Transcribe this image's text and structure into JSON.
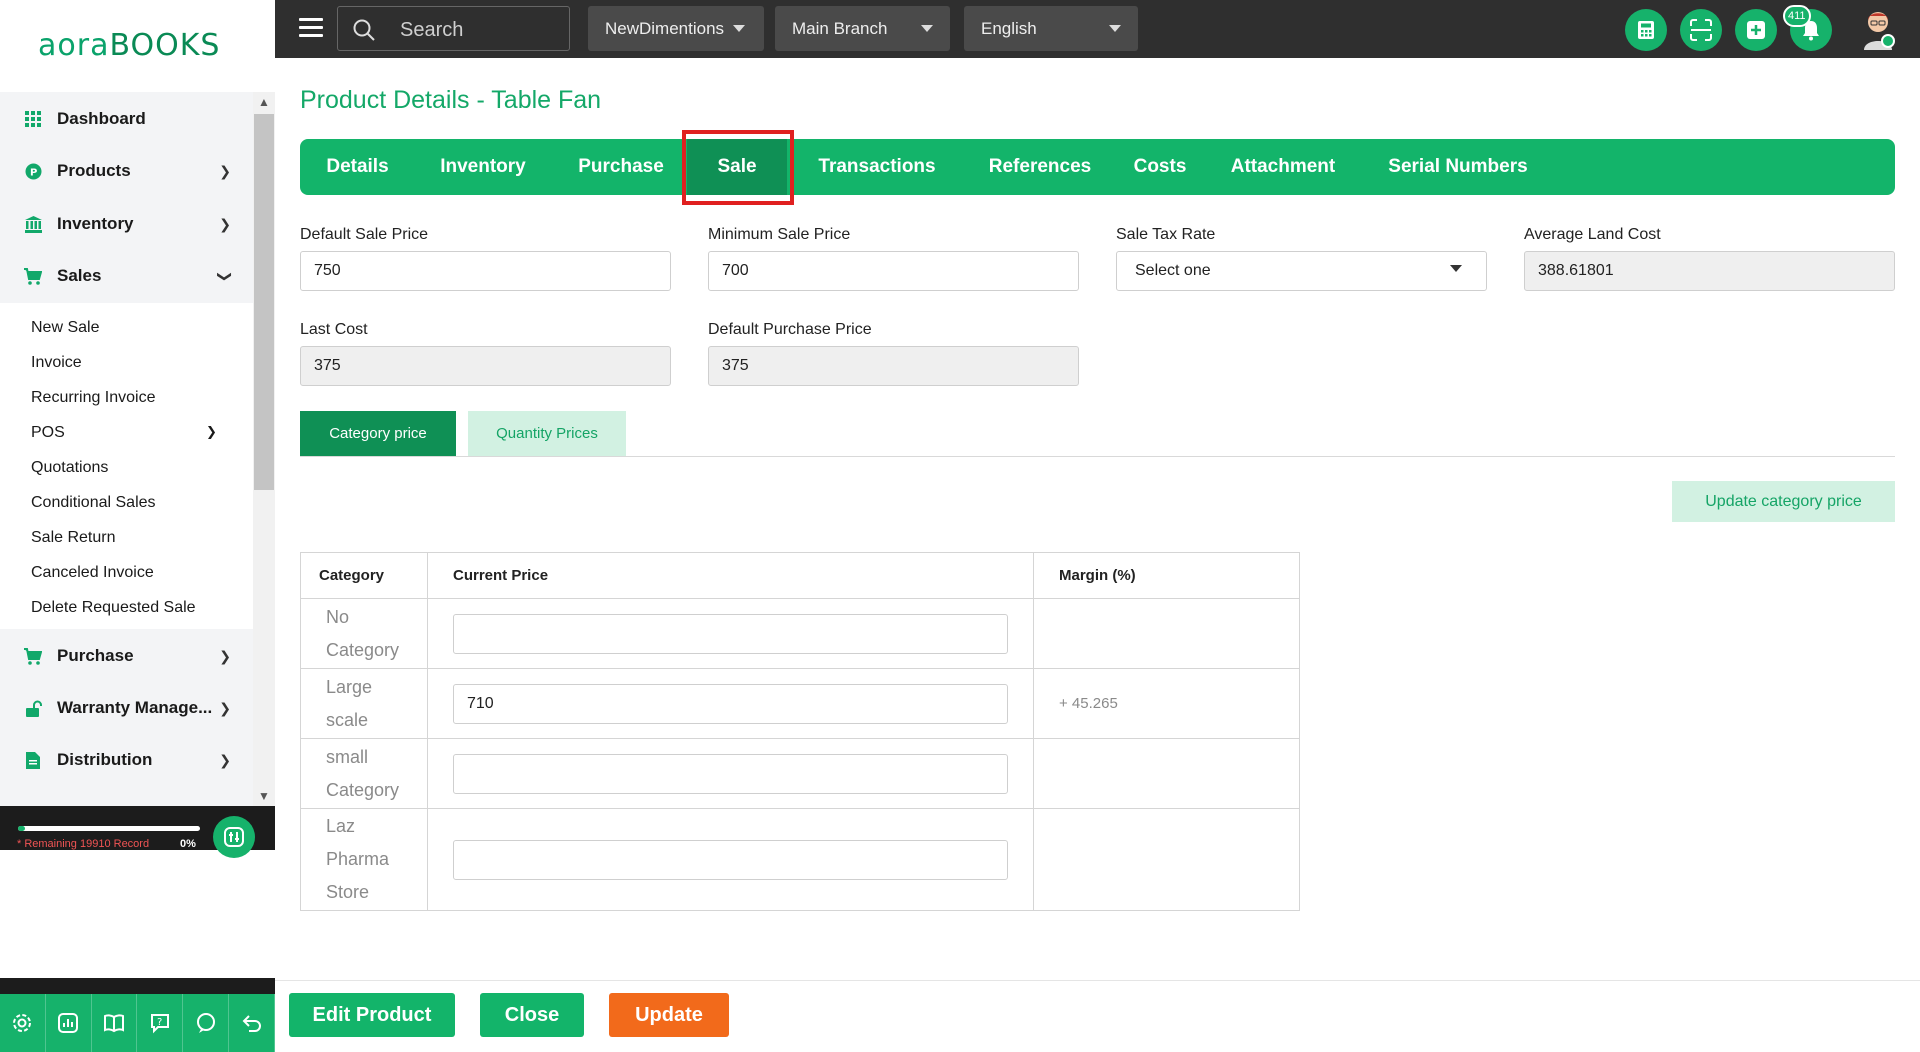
{
  "app": {
    "logo_main": "aora",
    "logo_books": "BOOKS"
  },
  "topbar": {
    "search_placeholder": "Search",
    "company": "NewDimentions",
    "branch": "Main Branch",
    "language": "English",
    "notification_count": "411"
  },
  "sidebar": {
    "items": [
      {
        "label": "Dashboard",
        "icon": "grid-icon"
      },
      {
        "label": "Products",
        "icon": "product-icon"
      },
      {
        "label": "Inventory",
        "icon": "bank-icon"
      },
      {
        "label": "Sales",
        "icon": "cart-icon"
      },
      {
        "label": "Purchase",
        "icon": "cart-icon"
      },
      {
        "label": "Warranty Manage...",
        "icon": "unlock-icon"
      },
      {
        "label": "Distribution",
        "icon": "document-icon"
      }
    ],
    "sales_sub": [
      "New Sale",
      "Invoice",
      "Recurring Invoice",
      "POS",
      "Quotations",
      "Conditional Sales",
      "Sale Return",
      "Canceled Invoice",
      "Delete Requested Sale"
    ],
    "remaining": "* Remaining 19910 Record",
    "percent": "0%",
    "progress": 0.04
  },
  "page": {
    "title": "Product Details - Table Fan",
    "tabs": [
      "Details",
      "Inventory",
      "Purchase",
      "Sale",
      "Transactions",
      "References",
      "Costs",
      "Attachment",
      "Serial Numbers"
    ],
    "active_tab": "Sale"
  },
  "fields": {
    "default_sale_price": {
      "label": "Default Sale Price",
      "value": "750"
    },
    "minimum_sale_price": {
      "label": "Minimum Sale Price",
      "value": "700"
    },
    "sale_tax_rate": {
      "label": "Sale Tax Rate",
      "value": "Select one"
    },
    "average_land_cost": {
      "label": "Average Land Cost",
      "value": "388.61801"
    },
    "last_cost": {
      "label": "Last Cost",
      "value": "375"
    },
    "default_purchase_price": {
      "label": "Default Purchase Price",
      "value": "375"
    }
  },
  "price_tabs": {
    "category": "Category price",
    "quantity": "Quantity Prices"
  },
  "update_category_label": "Update category price",
  "category_table": {
    "headers": [
      "Category",
      "Current Price",
      "Margin (%)"
    ],
    "rows": [
      {
        "category_l1": "No",
        "category_l2": "Category",
        "category_l3": "",
        "price": "",
        "margin": ""
      },
      {
        "category_l1": "Large",
        "category_l2": "scale",
        "category_l3": "",
        "price": "710",
        "margin": "+ 45.265"
      },
      {
        "category_l1": "small",
        "category_l2": "Category",
        "category_l3": "",
        "price": "",
        "margin": ""
      },
      {
        "category_l1": "Laz",
        "category_l2": "Pharma",
        "category_l3": "Store",
        "price": "",
        "margin": ""
      }
    ]
  },
  "actions": {
    "edit": "Edit Product",
    "close": "Close",
    "update": "Update"
  },
  "colors": {
    "brand": "#13b46a",
    "brand_dark": "#0f9055",
    "accent_orange": "#f26a1b",
    "highlight_red": "#e02020"
  }
}
